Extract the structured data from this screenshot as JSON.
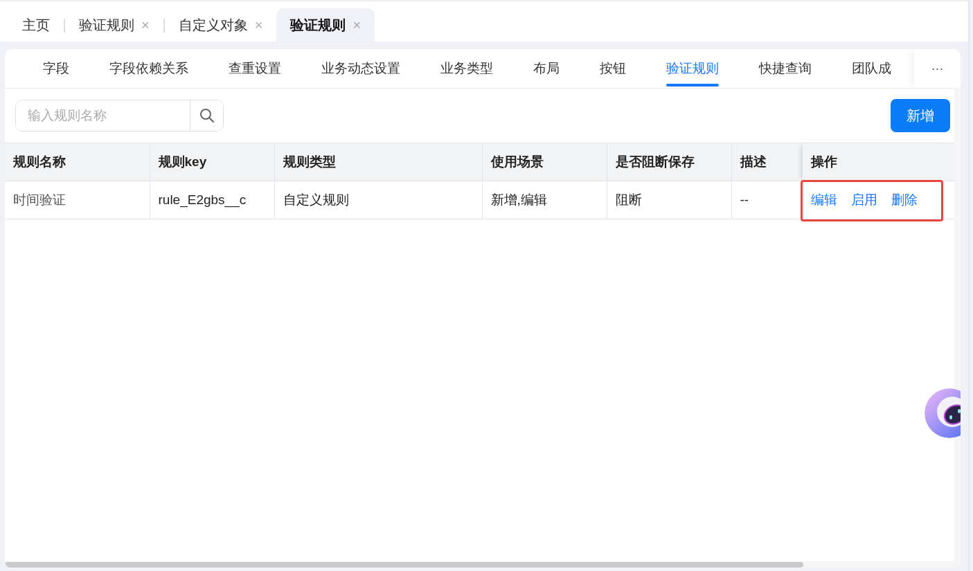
{
  "page_tabs": [
    {
      "label": "主页",
      "selected": false
    },
    {
      "label": "验证规则",
      "selected": false,
      "close": "×"
    },
    {
      "label": "自定义对象",
      "selected": false,
      "close": "×"
    },
    {
      "label": "验证规则",
      "selected": true,
      "close": "×"
    }
  ],
  "sub_tabs": [
    {
      "label": "字段",
      "selected": false
    },
    {
      "label": "字段依赖关系",
      "selected": false
    },
    {
      "label": "查重设置",
      "selected": false
    },
    {
      "label": "业务动态设置",
      "selected": false
    },
    {
      "label": "业务类型",
      "selected": false
    },
    {
      "label": "布局",
      "selected": false
    },
    {
      "label": "按钮",
      "selected": false
    },
    {
      "label": "验证规则",
      "selected": true
    },
    {
      "label": "快捷查询",
      "selected": false
    },
    {
      "label": "团队成",
      "selected": false
    }
  ],
  "more": "···",
  "search": {
    "placeholder": "输入规则名称"
  },
  "add_button": "新增",
  "table": {
    "columns": [
      "规则名称",
      "规则key",
      "规则类型",
      "使用场景",
      "是否阻断保存",
      "描述",
      "操作"
    ],
    "rows": [
      {
        "cells": [
          "时间验证",
          "rule_E2gbs__c",
          "自定义规则",
          "新增,编辑",
          "阻断",
          "--"
        ],
        "actions": [
          "编辑",
          "启用",
          "删除"
        ],
        "actions_highlighted": true
      }
    ]
  }
}
